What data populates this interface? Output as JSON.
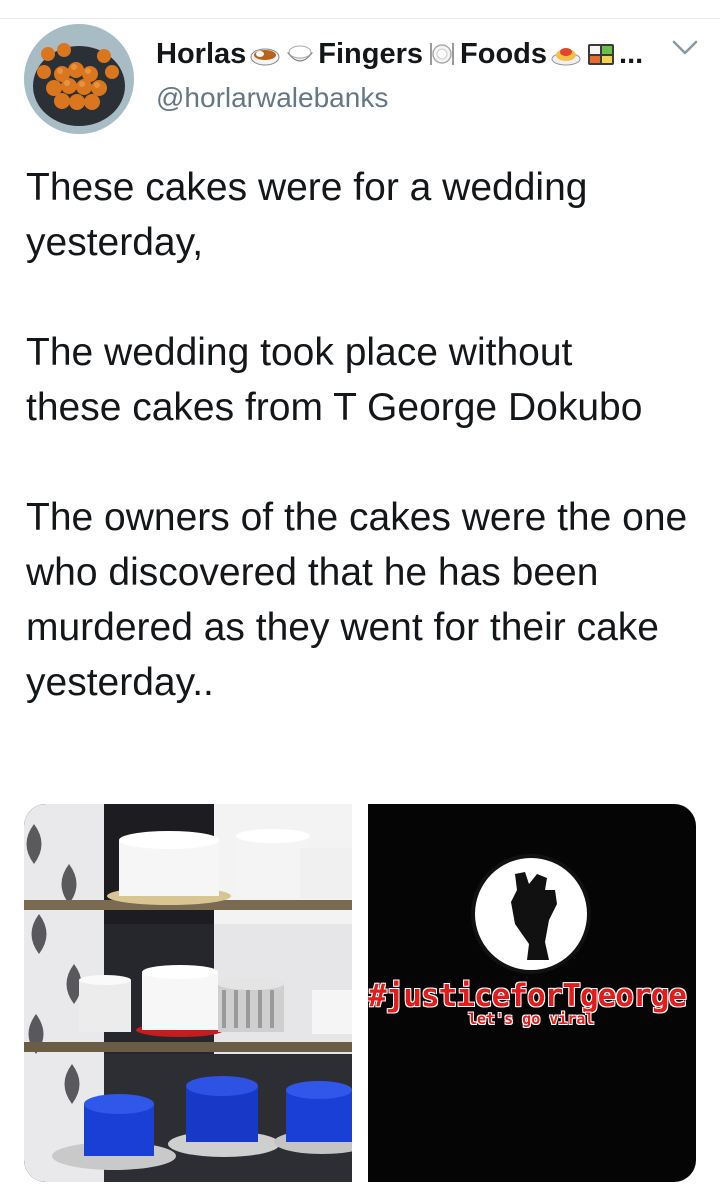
{
  "tweet": {
    "author": {
      "name_parts": [
        "Horlas",
        "Fingers",
        "Foods",
        "..."
      ],
      "name_emojis": [
        "curry-rice-emoji",
        "rice-bowl-emoji",
        "fork-knife-plate-emoji",
        "spaghetti-emoji",
        "bento-box-emoji"
      ],
      "handle": "@horlarwalebanks"
    },
    "paragraphs": [
      "These cakes were for a wedding yesterday,",
      "The wedding took place without these cakes from T George Dokubo",
      "The owners of the cakes were the one who discovered that he has been murdered as they went for their cake yesterday.."
    ],
    "media": [
      {
        "kind": "photo",
        "subject": "cakes-on-shelves"
      },
      {
        "kind": "graphic",
        "hashtag": "#justiceforTgeorge",
        "subtitle": "let's go viral",
        "icon": "raised-fist-icon"
      }
    ]
  },
  "colors": {
    "text": "#14171a",
    "secondary": "#657786",
    "hashtag_red": "#e31b1b",
    "blue_cake": "#1a3fd6"
  }
}
